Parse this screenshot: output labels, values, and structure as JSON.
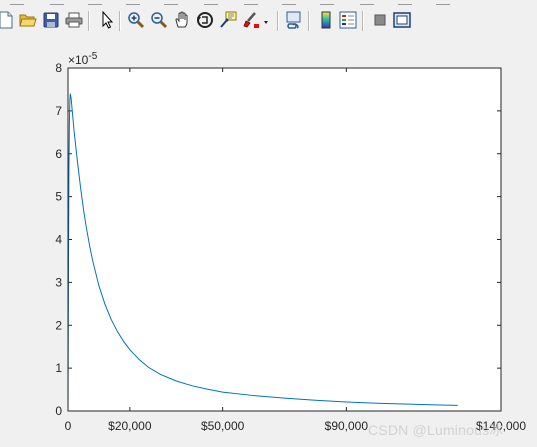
{
  "toolbar": {
    "buttons": [
      {
        "icon": "new-figure-icon"
      },
      {
        "icon": "open-file-icon"
      },
      {
        "icon": "save-figure-icon"
      },
      {
        "icon": "print-figure-icon"
      },
      {
        "icon": "edit-plot-icon"
      },
      {
        "icon": "zoom-in-icon"
      },
      {
        "icon": "zoom-out-icon"
      },
      {
        "icon": "pan-icon"
      },
      {
        "icon": "rotate-3d-icon"
      },
      {
        "icon": "data-cursor-icon"
      },
      {
        "icon": "brush-icon"
      },
      {
        "icon": "link-plot-icon"
      },
      {
        "icon": "insert-colorbar-icon"
      },
      {
        "icon": "insert-legend-icon"
      },
      {
        "icon": "hide-plot-tools-icon"
      },
      {
        "icon": "show-plot-tools-icon"
      }
    ]
  },
  "chart_data": {
    "type": "line",
    "exponent_label": "×10",
    "exponent_power": "-5",
    "xlim": [
      0,
      140000
    ],
    "ylim": [
      0,
      8
    ],
    "x_ticks": [
      {
        "value": 0,
        "label": "0"
      },
      {
        "value": 20000,
        "label": "$20,000"
      },
      {
        "value": 50000,
        "label": "$50,000"
      },
      {
        "value": 90000,
        "label": "$90,000"
      },
      {
        "value": 140000,
        "label": "$140,000"
      }
    ],
    "y_ticks": [
      {
        "value": 0,
        "label": "0"
      },
      {
        "value": 1,
        "label": "1"
      },
      {
        "value": 2,
        "label": "2"
      },
      {
        "value": 3,
        "label": "3"
      },
      {
        "value": 4,
        "label": "4"
      },
      {
        "value": 5,
        "label": "5"
      },
      {
        "value": 6,
        "label": "6"
      },
      {
        "value": 7,
        "label": "7"
      },
      {
        "value": 8,
        "label": "8"
      }
    ],
    "series": [
      {
        "color": "#0072BD",
        "points": [
          [
            0,
            0.0
          ],
          [
            150,
            3.2
          ],
          [
            300,
            5.6
          ],
          [
            450,
            6.7
          ],
          [
            600,
            7.25
          ],
          [
            750,
            7.4
          ],
          [
            1000,
            7.3
          ],
          [
            1500,
            6.9
          ],
          [
            2000,
            6.5
          ],
          [
            3000,
            5.85
          ],
          [
            4000,
            5.25
          ],
          [
            5000,
            4.7
          ],
          [
            6000,
            4.25
          ],
          [
            7000,
            3.85
          ],
          [
            8000,
            3.5
          ],
          [
            10000,
            2.92
          ],
          [
            12000,
            2.48
          ],
          [
            14000,
            2.13
          ],
          [
            16000,
            1.85
          ],
          [
            18000,
            1.62
          ],
          [
            20000,
            1.43
          ],
          [
            23000,
            1.2
          ],
          [
            26000,
            1.02
          ],
          [
            30000,
            0.85
          ],
          [
            35000,
            0.7
          ],
          [
            40000,
            0.59
          ],
          [
            45000,
            0.51
          ],
          [
            50000,
            0.44
          ],
          [
            60000,
            0.36
          ],
          [
            70000,
            0.3
          ],
          [
            80000,
            0.25
          ],
          [
            90000,
            0.21
          ],
          [
            100000,
            0.18
          ],
          [
            110000,
            0.16
          ],
          [
            120000,
            0.14
          ],
          [
            126000,
            0.13
          ]
        ]
      }
    ]
  },
  "watermark": "CSDN @Luminous冰"
}
